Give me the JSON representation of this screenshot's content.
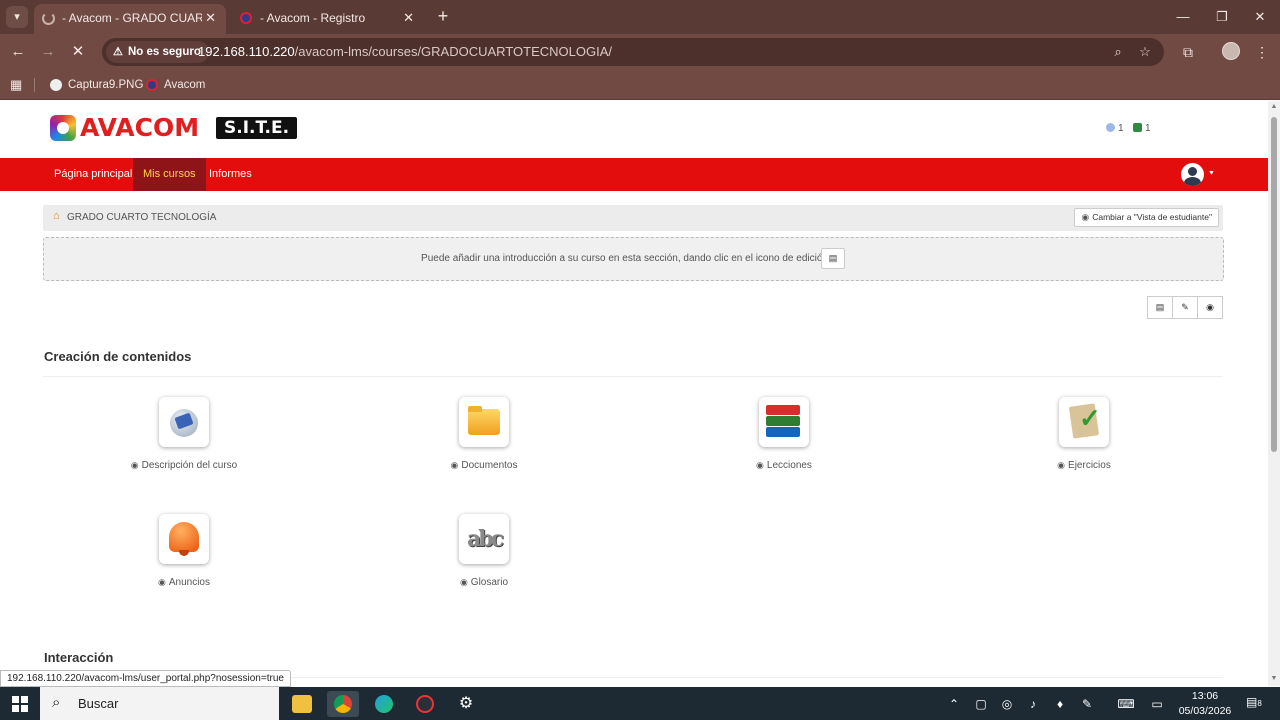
{
  "browser": {
    "tabs": [
      {
        "title": "- Avacom - GRADO CUARTO TE",
        "state": "loading"
      },
      {
        "title": "- Avacom - Registro",
        "state": "idle"
      }
    ],
    "security_label": "No es seguro",
    "url_host": "192.168.110.220",
    "url_path": "/avacom-lms/courses/GRADOCUARTOTECNOLOGIA/",
    "bookmarks": [
      {
        "label": "Captura9.PNG"
      },
      {
        "label": "Avacom"
      }
    ],
    "status_url": "192.168.110.220/avacom-lms/user_portal.php?nosession=true"
  },
  "header": {
    "logo_text": "AVACOM",
    "logo_badge": "S.I.T.E.",
    "users_count": "1",
    "messages_count": "1"
  },
  "nav": {
    "items": [
      {
        "label": "Página principal"
      },
      {
        "label": "Mis cursos"
      },
      {
        "label": "Informes"
      }
    ],
    "active_index": 1
  },
  "course": {
    "breadcrumb": "GRADO CUARTO TECNOLOGÍA",
    "student_view_label": "Cambiar a \"Vista de estudiante\"",
    "intro_text": "Puede añadir una introducción a su curso en esta sección, dando clic en el icono de edición"
  },
  "sections": [
    {
      "title": "Creación de contenidos",
      "tools": [
        {
          "label": "Descripción del curso",
          "icon": "course-description-icon"
        },
        {
          "label": "Documentos",
          "icon": "folder-icon"
        },
        {
          "label": "Lecciones",
          "icon": "books-icon"
        },
        {
          "label": "Ejercicios",
          "icon": "exercises-icon"
        },
        {
          "label": "Anuncios",
          "icon": "bell-icon"
        },
        {
          "label": "Glosario",
          "icon": "glossary-icon",
          "icon_text": "abc"
        }
      ]
    },
    {
      "title": "Interacción"
    }
  ],
  "taskbar": {
    "search_placeholder": "Buscar",
    "time": "13:06",
    "date": "05/03/2026",
    "notifications": "8"
  },
  "colors": {
    "navbar": "#e30d0d",
    "nav_active": "#8e1418",
    "browser_frame": "#714a44"
  }
}
